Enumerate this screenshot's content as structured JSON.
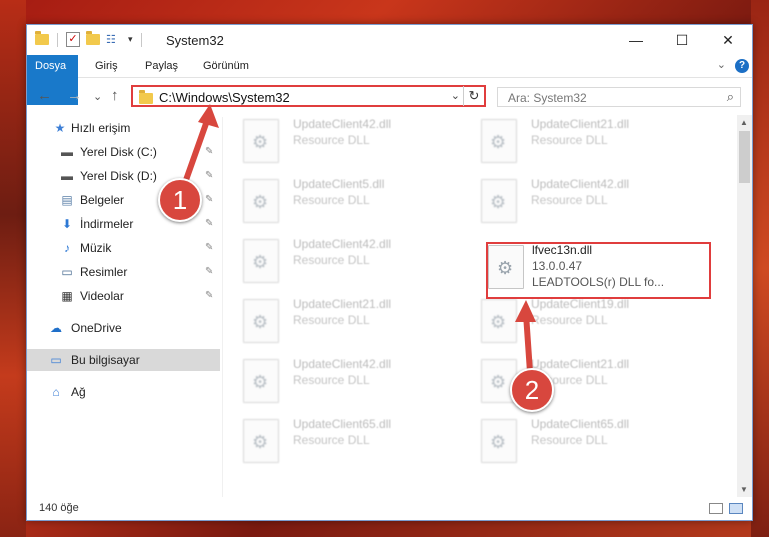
{
  "window": {
    "title": "System32"
  },
  "titlebar": {
    "minimize": "—",
    "maximize": "☐",
    "close": "✕",
    "customize": "▾"
  },
  "ribbon": {
    "tabs": [
      "Dosya",
      "Giriş",
      "Paylaş",
      "Görünüm"
    ],
    "help": "?",
    "collapse": "⌄"
  },
  "nav_buttons": {
    "back": "←",
    "forward": "→",
    "recent": "⌄",
    "up": "↑"
  },
  "address": {
    "path": "C:\\Windows\\System32",
    "dropdown": "⌄",
    "refresh": "↻"
  },
  "search": {
    "placeholder": "Ara: System32",
    "icon": "⌕"
  },
  "navpane": {
    "items": [
      {
        "label": "Hızlı erişim",
        "icon": "star-icon",
        "glyph": "★",
        "pinned": false
      },
      {
        "label": "Yerel Disk (C:)",
        "icon": "drive-icon",
        "glyph": "▬",
        "pinned": true
      },
      {
        "label": "Yerel Disk (D:)",
        "icon": "drive-icon",
        "glyph": "▬",
        "pinned": true
      },
      {
        "label": "Belgeler",
        "icon": "documents-icon",
        "glyph": "▤",
        "pinned": true
      },
      {
        "label": "İndirmeler",
        "icon": "downloads-icon",
        "glyph": "⬇",
        "pinned": true
      },
      {
        "label": "Müzik",
        "icon": "music-icon",
        "glyph": "♪",
        "pinned": true
      },
      {
        "label": "Resimler",
        "icon": "pictures-icon",
        "glyph": "▭",
        "pinned": true
      },
      {
        "label": "Videolar",
        "icon": "videos-icon",
        "glyph": "▦",
        "pinned": true
      },
      {
        "label": "OneDrive",
        "icon": "cloud-icon",
        "glyph": "☁",
        "pinned": false
      },
      {
        "label": "Bu bilgisayar",
        "icon": "computer-icon",
        "glyph": "▭",
        "pinned": false,
        "selected": true
      },
      {
        "label": "Ağ",
        "icon": "network-icon",
        "glyph": "⌂",
        "pinned": false
      }
    ],
    "pin_glyph": "📌"
  },
  "files": [
    {
      "name": "UpdateClient42.dll",
      "desc": "Resource DLL"
    },
    {
      "name": "UpdateClient21.dll",
      "desc": "Resource DLL"
    },
    {
      "name": "UpdateClient5.dll",
      "desc": "Resource DLL"
    },
    {
      "name": "UpdateClient42.dll",
      "desc": "Resource DLL"
    },
    {
      "name": "UpdateClient42.dll",
      "desc": "Resource DLL"
    },
    {
      "name": "lfvec13n.dll",
      "desc": "13.0.0.47",
      "desc2": "LEADTOOLS(r) DLL fo..."
    },
    {
      "name": "UpdateClient21.dll",
      "desc": "Resource DLL"
    },
    {
      "name": "UpdateClient19.dll",
      "desc": "Resource DLL"
    },
    {
      "name": "UpdateClient42.dll",
      "desc": "Resource DLL"
    },
    {
      "name": "UpdateClient21.dll",
      "desc": "Resource DLL"
    },
    {
      "name": "UpdateClient65.dll",
      "desc": "Resource DLL"
    },
    {
      "name": "UpdateClient65.dll",
      "desc": "Resource DLL"
    }
  ],
  "status": {
    "count": "140 öğe"
  },
  "callouts": [
    "1",
    "2"
  ],
  "colors": {
    "accent": "#1979ca",
    "highlight": "#e03d3d",
    "callout": "#d8473e"
  }
}
